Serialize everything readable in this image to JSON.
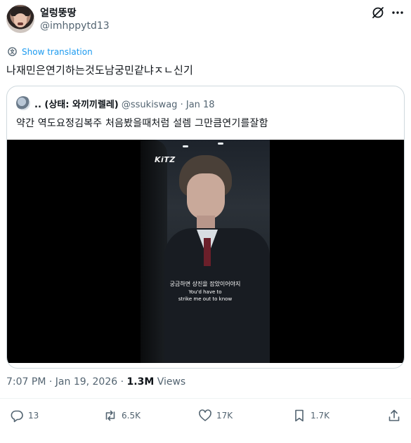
{
  "author": {
    "display_name": "얼렁뚱땅",
    "handle": "@imhppytd13"
  },
  "translate_label": "Show translation",
  "tweet_text": "나재민은연기하는것도남궁민같냐ㅈㄴ신기",
  "quoted": {
    "display_name": ".. (상태: 와끼끼렐레)",
    "handle": "@ssukiswag",
    "separator": "·",
    "date": "Jan 18",
    "text": "약간  역도요정김복주 처음봤을때처럼 설렘  그만큼연기를잘함",
    "video": {
      "logo": "KiTZ",
      "subtitle_ko": "궁금하면 상진을 잡았이어야지",
      "subtitle_en_line1": "You'd have to",
      "subtitle_en_line2": "strike me out to know"
    }
  },
  "meta": {
    "time": "7:07 PM",
    "separator": "·",
    "date": "Jan 19, 2026",
    "separator2": "·",
    "views_count": "1.3M",
    "views_label": "Views"
  },
  "actions": {
    "replies": "13",
    "reposts": "6.5K",
    "likes": "17K",
    "bookmarks": "1.7K"
  },
  "colors": {
    "accent": "#1d9bf0",
    "text_primary": "#0f1419",
    "text_secondary": "#536471",
    "border": "#cfd9de"
  },
  "icons": [
    "grok-icon",
    "more-icon",
    "translate-icon",
    "reply-icon",
    "repost-icon",
    "like-icon",
    "bookmark-icon",
    "share-icon"
  ]
}
